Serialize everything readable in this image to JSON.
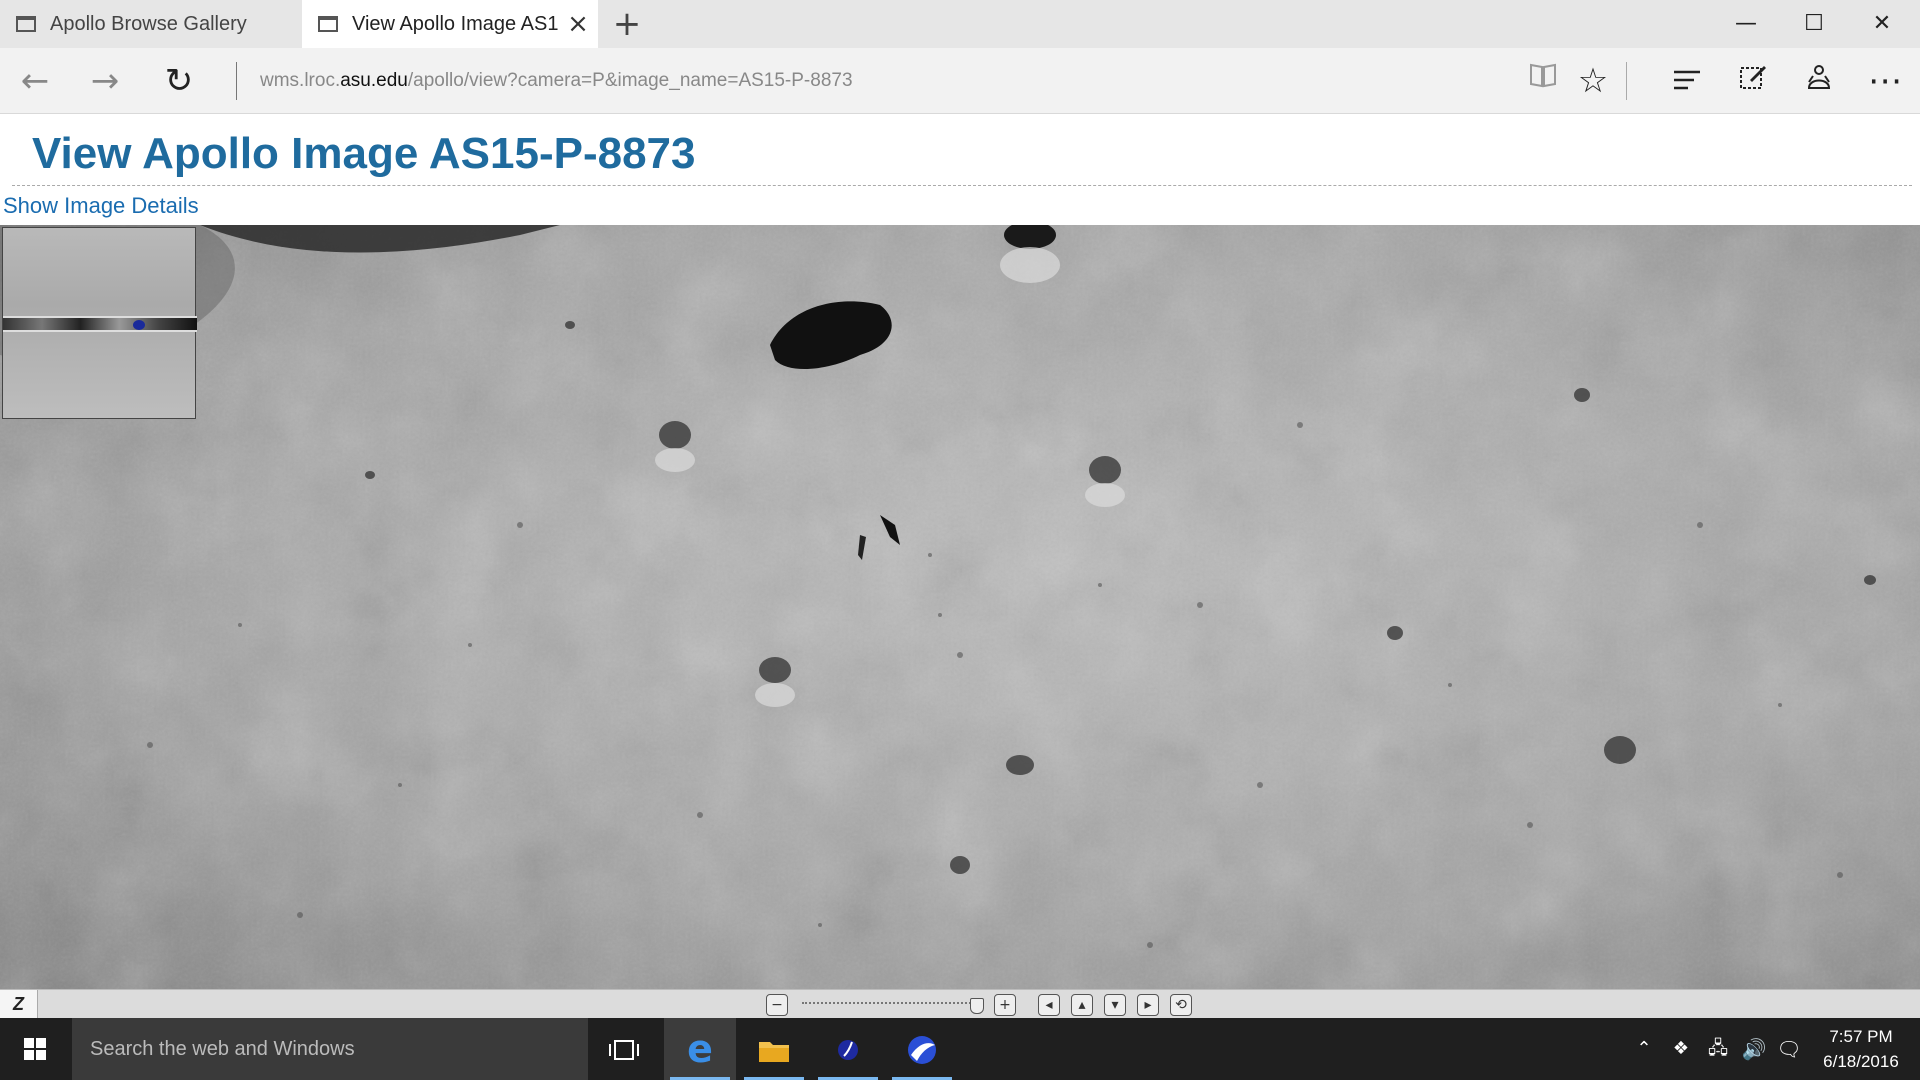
{
  "browser": {
    "tabs": [
      {
        "title": "Apollo Browse Gallery",
        "active": false
      },
      {
        "title": "View Apollo Image AS15-P-8873",
        "active": true
      }
    ],
    "new_tab_icon": "plus-icon",
    "url_prefix": "wms.lroc.",
    "url_host": "asu.edu",
    "url_path": "/apollo/view?camera=P&image_name=AS15-P-8873",
    "icons": {
      "back": "←",
      "forward": "→",
      "refresh": "↻",
      "reading_view": "📖",
      "favorite": "☆",
      "hub": "☰",
      "note": "✎",
      "share": "⇪",
      "more": "⋯",
      "minimize": "—",
      "maximize": "☐",
      "close": "✕"
    }
  },
  "page": {
    "title": "View Apollo Image AS15-P-8873",
    "details_link": "Show Image Details"
  },
  "zoombar": {
    "logo": "Z",
    "zoom_out": "−",
    "zoom_in": "+",
    "pan_left": "◂",
    "pan_up": "▴",
    "pan_down": "▾",
    "pan_right": "▸",
    "reset": "⟲"
  },
  "taskbar": {
    "search_placeholder": "Search the web and Windows",
    "time": "7:57 PM",
    "date": "6/18/2016"
  },
  "colors": {
    "title_blue": "#1f6b9e",
    "link_blue": "#1a6cb0",
    "taskbar": "#1f1f1f"
  }
}
